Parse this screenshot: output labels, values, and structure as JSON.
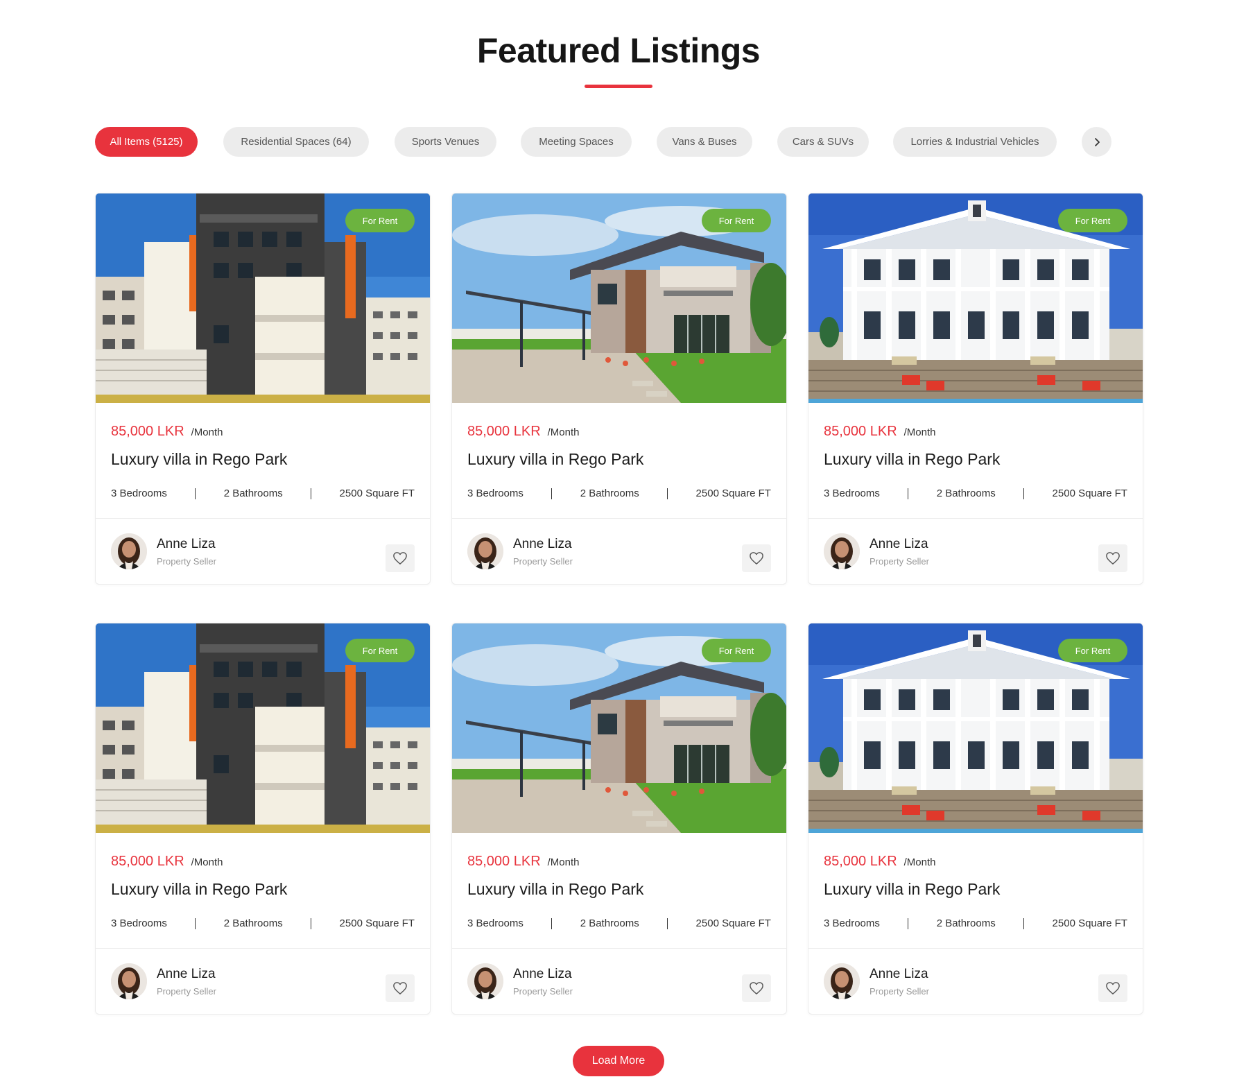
{
  "section": {
    "title": "Featured Listings",
    "accent_color": "#e8333d",
    "badge_color": "#6cb33f"
  },
  "filters": {
    "chips": [
      {
        "label": "All Items (5125)",
        "active": true
      },
      {
        "label": "Residential Spaces (64)",
        "active": false
      },
      {
        "label": "Sports Venues",
        "active": false
      },
      {
        "label": "Meeting Spaces",
        "active": false
      },
      {
        "label": "Vans & Buses",
        "active": false
      },
      {
        "label": "Cars & SUVs",
        "active": false
      },
      {
        "label": "Lorries & Industrial Vehicles",
        "active": false
      }
    ],
    "next_icon": "chevron-right-icon"
  },
  "listings": [
    {
      "image": "modern-apartment-building",
      "badge": "For Rent",
      "price": "85,000 LKR",
      "period": "/Month",
      "title": "Luxury villa in Rego Park",
      "bedrooms": "3 Bedrooms",
      "bathrooms": "2 Bathrooms",
      "area": "2500 Square FT",
      "seller_name": "Anne Liza",
      "seller_role": "Property Seller",
      "fav_icon": "heart-icon"
    },
    {
      "image": "two-storey-house-with-carport",
      "badge": "For Rent",
      "price": "85,000 LKR",
      "period": "/Month",
      "title": "Luxury villa in Rego Park",
      "bedrooms": "3 Bedrooms",
      "bathrooms": "2 Bathrooms",
      "area": "2500 Square FT",
      "seller_name": "Anne Liza",
      "seller_role": "Property Seller",
      "fav_icon": "heart-icon"
    },
    {
      "image": "white-colonial-beach-house",
      "badge": "For Rent",
      "price": "85,000 LKR",
      "period": "/Month",
      "title": "Luxury villa in Rego Park",
      "bedrooms": "3 Bedrooms",
      "bathrooms": "2 Bathrooms",
      "area": "2500 Square FT",
      "seller_name": "Anne Liza",
      "seller_role": "Property Seller",
      "fav_icon": "heart-icon"
    },
    {
      "image": "modern-apartment-building",
      "badge": "For Rent",
      "price": "85,000 LKR",
      "period": "/Month",
      "title": "Luxury villa in Rego Park",
      "bedrooms": "3 Bedrooms",
      "bathrooms": "2 Bathrooms",
      "area": "2500 Square FT",
      "seller_name": "Anne Liza",
      "seller_role": "Property Seller",
      "fav_icon": "heart-icon"
    },
    {
      "image": "two-storey-house-with-carport",
      "badge": "For Rent",
      "price": "85,000 LKR",
      "period": "/Month",
      "title": "Luxury villa in Rego Park",
      "bedrooms": "3 Bedrooms",
      "bathrooms": "2 Bathrooms",
      "area": "2500 Square FT",
      "seller_name": "Anne Liza",
      "seller_role": "Property Seller",
      "fav_icon": "heart-icon"
    },
    {
      "image": "white-colonial-beach-house",
      "badge": "For Rent",
      "price": "85,000 LKR",
      "period": "/Month",
      "title": "Luxury villa in Rego Park",
      "bedrooms": "3 Bedrooms",
      "bathrooms": "2 Bathrooms",
      "area": "2500 Square FT",
      "seller_name": "Anne Liza",
      "seller_role": "Property Seller",
      "fav_icon": "heart-icon"
    }
  ],
  "load_more": {
    "label": "Load More"
  }
}
